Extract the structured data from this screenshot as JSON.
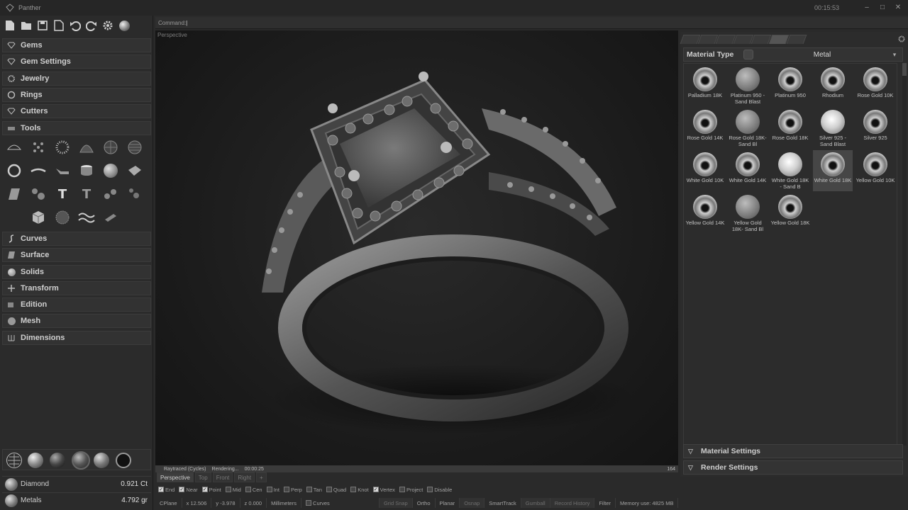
{
  "app": {
    "title": "Panther",
    "clock": "00:15:53"
  },
  "left_panel": {
    "sections": [
      {
        "id": "gems",
        "label": "Gems",
        "icon": "gem-icon"
      },
      {
        "id": "gem-settings",
        "label": "Gem Settings",
        "icon": "gem-settings-icon"
      },
      {
        "id": "jewelry",
        "label": "Jewelry",
        "icon": "gear-icon"
      },
      {
        "id": "rings",
        "label": "Rings",
        "icon": "ring-icon"
      },
      {
        "id": "cutters",
        "label": "Cutters",
        "icon": "cutter-icon"
      },
      {
        "id": "tools",
        "label": "Tools",
        "icon": "tools-icon"
      },
      {
        "id": "curves",
        "label": "Curves",
        "icon": "curve-icon"
      },
      {
        "id": "surface",
        "label": "Surface",
        "icon": "surface-icon"
      },
      {
        "id": "solids",
        "label": "Solids",
        "icon": "sphere-icon"
      },
      {
        "id": "transform",
        "label": "Transform",
        "icon": "transform-icon"
      },
      {
        "id": "edition",
        "label": "Edition",
        "icon": "edit-icon"
      },
      {
        "id": "mesh",
        "label": "Mesh",
        "icon": "mesh-icon"
      },
      {
        "id": "dimensions",
        "label": "Dimensions",
        "icon": "dimensions-icon"
      }
    ],
    "summary": {
      "diamond_label": "Diamond",
      "diamond_value": "0.921 Ct",
      "metals_label": "Metals",
      "metals_value": "4.792 gr"
    }
  },
  "command": {
    "label": "Command:"
  },
  "viewport": {
    "label": "Perspective",
    "render_mode": "Raytraced (Cycles)",
    "render_state": "Rendering...",
    "render_time": "00:00:25",
    "render_passes": "164",
    "tabs": [
      "Perspective",
      "Top",
      "Front",
      "Right"
    ]
  },
  "osnaps": [
    {
      "label": "End",
      "on": true
    },
    {
      "label": "Near",
      "on": true
    },
    {
      "label": "Point",
      "on": true
    },
    {
      "label": "Mid",
      "on": false
    },
    {
      "label": "Cen",
      "on": false
    },
    {
      "label": "Int",
      "on": false
    },
    {
      "label": "Perp",
      "on": false
    },
    {
      "label": "Tan",
      "on": false
    },
    {
      "label": "Quad",
      "on": false
    },
    {
      "label": "Knot",
      "on": false
    },
    {
      "label": "Vertex",
      "on": true
    },
    {
      "label": "Project",
      "on": false
    },
    {
      "label": "Disable",
      "on": false
    }
  ],
  "statusbar": {
    "cplane": "CPlane",
    "x": "x 12.506",
    "y": "y -3.978",
    "z": "z 0.000",
    "units": "Millimeters",
    "layer": "Curves",
    "toggles": [
      {
        "label": "Grid Snap",
        "dim": true
      },
      {
        "label": "Ortho",
        "dim": false
      },
      {
        "label": "Planar",
        "dim": false
      },
      {
        "label": "Osnap",
        "dim": true
      },
      {
        "label": "SmartTrack",
        "dim": false
      },
      {
        "label": "Gumball",
        "dim": true
      },
      {
        "label": "Record History",
        "dim": true
      },
      {
        "label": "Filter",
        "dim": false
      }
    ],
    "memory": "Memory use: 4825 MB"
  },
  "right_panel": {
    "material_type_label": "Material Type",
    "material_type_value": "Metal",
    "materials": [
      {
        "name": "Palladium 18K",
        "style": "chrome"
      },
      {
        "name": "Platinum 950 - Sand Blast",
        "style": "matte"
      },
      {
        "name": "Platinum 950",
        "style": "chrome"
      },
      {
        "name": "Rhodium",
        "style": "chrome"
      },
      {
        "name": "Rose Gold 10K",
        "style": "chrome"
      },
      {
        "name": "Rose Gold 14K",
        "style": "chrome"
      },
      {
        "name": "Rose Gold 18K- Sand Bl",
        "style": "matte"
      },
      {
        "name": "Rose Gold 18K",
        "style": "chrome"
      },
      {
        "name": "Silver 925 - Sand Blast",
        "style": "bright"
      },
      {
        "name": "Silver 925",
        "style": "chrome"
      },
      {
        "name": "White Gold 10K",
        "style": "chrome"
      },
      {
        "name": "White Gold 14K",
        "style": "chrome"
      },
      {
        "name": "White Gold 18K - Sand B",
        "style": "bright"
      },
      {
        "name": "White Gold 18K",
        "style": "chrome",
        "selected": true
      },
      {
        "name": "Yellow Gold 10K",
        "style": "chrome"
      },
      {
        "name": "Yellow Gold 14K",
        "style": "chrome"
      },
      {
        "name": "Yellow Gold 18K- Sand Bl",
        "style": "matte"
      },
      {
        "name": "Yellow Gold 18K",
        "style": "chrome"
      }
    ],
    "material_settings_label": "Material Settings",
    "render_settings_label": "Render Settings"
  }
}
